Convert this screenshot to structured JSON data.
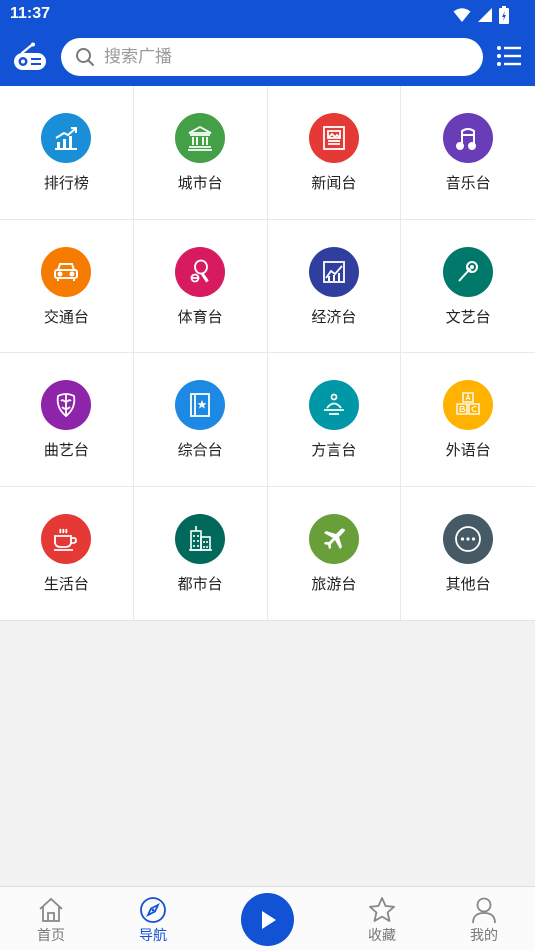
{
  "status_bar": {
    "time": "11:37"
  },
  "header": {
    "search_placeholder": "搜索广播"
  },
  "categories": [
    {
      "label": "排行榜",
      "icon": "trending-chart-icon",
      "color": "#1a8fd8"
    },
    {
      "label": "城市台",
      "icon": "city-hall-icon",
      "color": "#43a047"
    },
    {
      "label": "新闻台",
      "icon": "newspaper-icon",
      "color": "#e53935"
    },
    {
      "label": "音乐台",
      "icon": "music-note-icon",
      "color": "#6a3db8"
    },
    {
      "label": "交通台",
      "icon": "car-icon",
      "color": "#f57c00"
    },
    {
      "label": "体育台",
      "icon": "table-tennis-icon",
      "color": "#d81b60"
    },
    {
      "label": "经济台",
      "icon": "economy-chart-icon",
      "color": "#303f9f"
    },
    {
      "label": "文艺台",
      "icon": "microphone-icon",
      "color": "#00796b"
    },
    {
      "label": "曲艺台",
      "icon": "opera-mask-icon",
      "color": "#8e24aa"
    },
    {
      "label": "综合台",
      "icon": "book-star-icon",
      "color": "#1e88e5"
    },
    {
      "label": "方言台",
      "icon": "speaker-person-icon",
      "color": "#0097a7"
    },
    {
      "label": "外语台",
      "icon": "abc-blocks-icon",
      "color": "#ffb300"
    },
    {
      "label": "生活台",
      "icon": "coffee-cup-icon",
      "color": "#e53935"
    },
    {
      "label": "都市台",
      "icon": "buildings-icon",
      "color": "#00695c"
    },
    {
      "label": "旅游台",
      "icon": "airplane-icon",
      "color": "#689f38"
    },
    {
      "label": "其他台",
      "icon": "more-dots-icon",
      "color": "#455a64"
    }
  ],
  "bottom_nav": {
    "home": "首页",
    "navigation": "导航",
    "favorites": "收藏",
    "mine": "我的"
  },
  "colors": {
    "primary": "#1252d4"
  }
}
